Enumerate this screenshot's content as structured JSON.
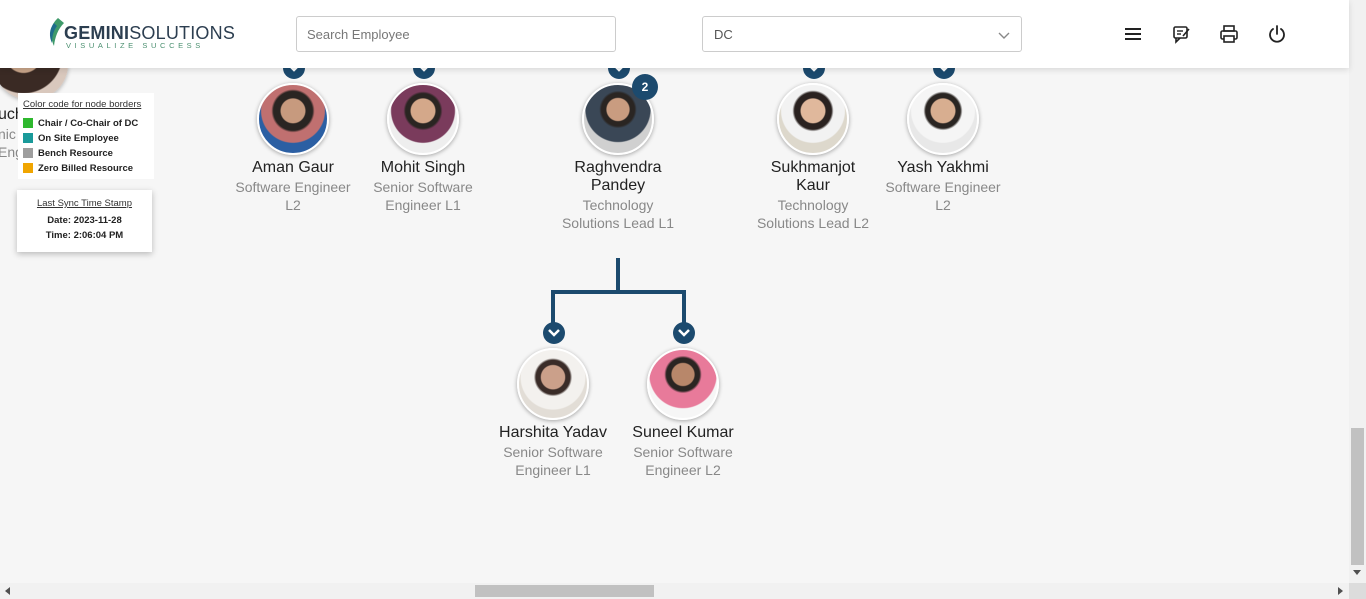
{
  "header": {
    "brand_bold": "GEMINI",
    "brand_light": "SOLUTIONS",
    "tagline": "VISUALIZE SUCCESS",
    "search_placeholder": "Search Employee",
    "dc_select_value": "DC",
    "icons": [
      "menu-icon",
      "feedback-icon",
      "print-icon",
      "power-icon"
    ]
  },
  "legend": {
    "title": "Color code for node borders",
    "items": [
      {
        "label": "Chair / Co-Chair of DC",
        "color": "#2eb82e"
      },
      {
        "label": "On Site Employee",
        "color": "#1a9a9a"
      },
      {
        "label": "Bench Resource",
        "color": "#9e9e9e"
      },
      {
        "label": "Zero Billed Resource",
        "color": "#f0a500"
      }
    ]
  },
  "sync": {
    "title": "Last Sync Time Stamp",
    "date": "Date: 2023-11-28",
    "time": "Time: 2:06:04 PM"
  },
  "partial_node": {
    "name_fragment": "uch",
    "role_line1": "nic",
    "role_line2": "Eng"
  },
  "top_row": [
    {
      "name": "Aman Gaur",
      "role1": "Software Engineer",
      "role2": "L2"
    },
    {
      "name": "Mohit Singh",
      "role1": "Senior Software",
      "role2": "Engineer L1"
    },
    {
      "name": "Raghvendra",
      "name2": "Pandey",
      "role1": "Technology",
      "role2": "Solutions Lead L1",
      "reports": "2"
    },
    {
      "name": "Sukhmanjot",
      "name2": "Kaur",
      "role1": "Technology",
      "role2": "Solutions Lead L2"
    },
    {
      "name": "Yash Yakhmi",
      "role1": "Software Engineer",
      "role2": "L2"
    }
  ],
  "children": [
    {
      "name": "Harshita Yadav",
      "role1": "Senior Software",
      "role2": "Engineer L1"
    },
    {
      "name": "Suneel Kumar",
      "role1": "Senior Software",
      "role2": "Engineer L2"
    }
  ],
  "colors": {
    "accent": "#1c4a6e",
    "background": "#f6f6f6"
  }
}
